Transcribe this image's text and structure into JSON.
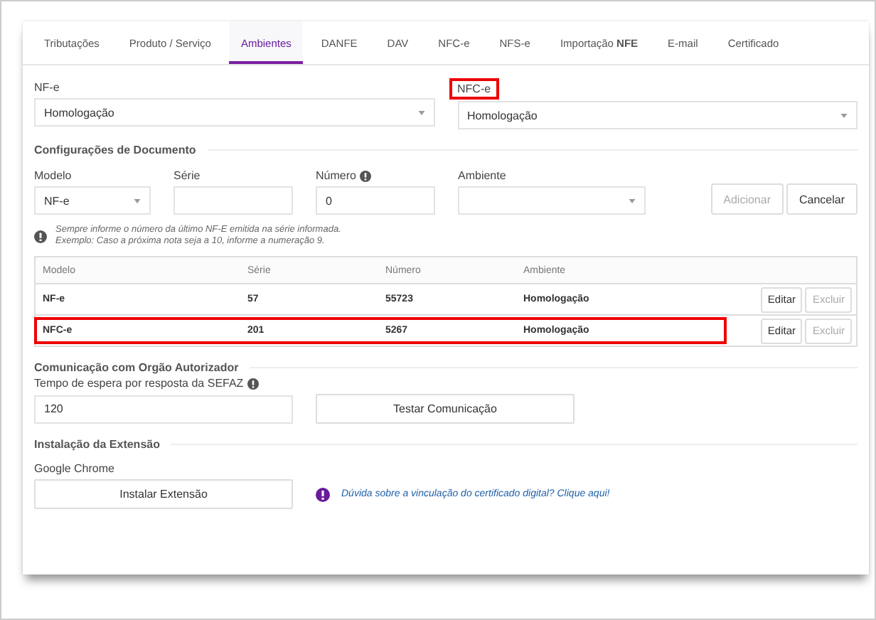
{
  "tabs": [
    {
      "label": "Tributações",
      "selected": false
    },
    {
      "label": "Produto / Serviço",
      "selected": false
    },
    {
      "label": "Ambientes",
      "selected": true
    },
    {
      "label": "DANFE",
      "selected": false
    },
    {
      "label": "DAV",
      "selected": false
    },
    {
      "label": "NFC-e",
      "selected": false
    },
    {
      "label": "NFS-e",
      "selected": false
    },
    {
      "label": "Importação **NFE**",
      "selected": false
    },
    {
      "label": "E-mail",
      "selected": false
    },
    {
      "label": "Certificado",
      "selected": false
    }
  ],
  "environments": [
    {
      "label": "NF-e",
      "value": "Homologação",
      "highlighted": false
    },
    {
      "label": "NFC-e",
      "value": "Homologação",
      "highlighted": true
    }
  ],
  "document_config": {
    "title": "Configurações de Documento",
    "fields": [
      {
        "kind": "select",
        "label": "Modelo",
        "value": "NF-e"
      },
      {
        "kind": "text",
        "label": "Série"
      },
      {
        "kind": "text",
        "label": "Número",
        "info": true,
        "value": "0"
      },
      {
        "kind": "select",
        "label": "Ambiente"
      }
    ],
    "buttons": [
      {
        "label": "Adicionar",
        "disabled": true
      },
      {
        "label": "Cancelar",
        "disabled": false
      }
    ],
    "note": [
      "Sempre informe o número da último NF-E emitida na série informada.",
      "Exemplo: Caso a próxima nota seja a 10, informe a numeração 9."
    ],
    "table": {
      "columns": [
        "Modelo",
        "Série",
        "Número",
        "Ambiente"
      ],
      "rows": [
        {
          "cells": [
            "NF-e",
            "57",
            "55723",
            "Homologação"
          ],
          "highlighted": false,
          "actions": [
            {
              "label": "Editar",
              "disabled": false
            },
            {
              "label": "Excluir",
              "disabled": true
            }
          ]
        },
        {
          "cells": [
            "NFC-e",
            "201",
            "5267",
            "Homologação"
          ],
          "highlighted": true,
          "actions": [
            {
              "label": "Editar",
              "disabled": false
            },
            {
              "label": "Excluir",
              "disabled": true
            }
          ]
        }
      ]
    }
  },
  "communication": {
    "title": "Comunicação com Orgão Autorizador",
    "label": "Tempo de espera por resposta da SEFAZ",
    "value": "120",
    "button": "Testar Comunicação"
  },
  "extension": {
    "title": "Instalação da Extensão",
    "label": "Google Chrome",
    "button": "Instalar Extensão",
    "link": "Dúvida sobre a vinculação do certificado digital? Clique aqui!"
  }
}
